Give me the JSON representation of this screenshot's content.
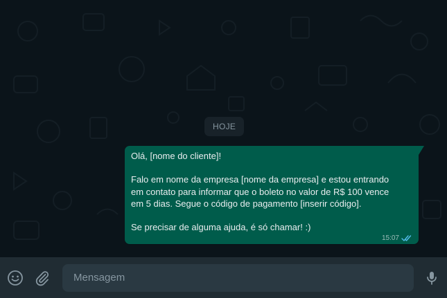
{
  "chat": {
    "date_label": "HOJE",
    "message": {
      "lines": [
        "Olá, [nome do cliente]!",
        "",
        "Falo em nome da empresa [nome da empresa] e estou entrando",
        "em contato para informar que o boleto no valor de R$ 100 vence",
        "em 5 dias. Segue o código de pagamento [inserir código].",
        "",
        "Se precisar de alguma ajuda, é só chamar! :)"
      ],
      "time": "15:07",
      "status_icon": "double-check-read-icon"
    }
  },
  "composer": {
    "placeholder": "Mensagem",
    "emoji_icon": "emoji-icon",
    "attach_icon": "paperclip-icon",
    "mic_icon": "microphone-icon"
  },
  "colors": {
    "chat_background": "#0b141a",
    "outgoing_bubble": "#005c4b",
    "composer_bar": "#202c33",
    "input_field": "#2a3942",
    "read_ticks": "#53bdeb"
  }
}
